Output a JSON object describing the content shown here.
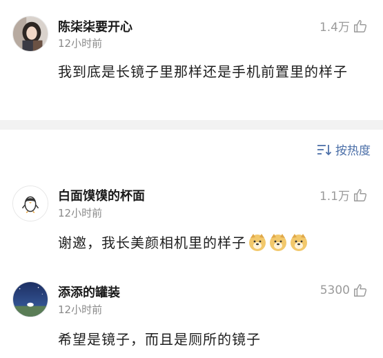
{
  "comments": [
    {
      "username": "陈柒柒要开心",
      "time": "12小时前",
      "likes": "1.4万",
      "content": "我到底是长镜子里那样还是手机前置里的样子",
      "avatar_icon": "girl-portrait-avatar"
    },
    {
      "username": "白面馍馍的杯面",
      "time": "12小时前",
      "likes": "1.1万",
      "content": "谢邀，我长美颜相机里的样子",
      "avatar_icon": "penguin-sketch-avatar",
      "emoji_icon": "doge-emoji",
      "emoji_count": 3
    },
    {
      "username": "添添的罐装",
      "time": "12小时前",
      "likes": "5300",
      "content": "希望是镜子，而且是厕所的镜子",
      "avatar_icon": "night-sky-landscape-avatar"
    }
  ],
  "sort": {
    "label": "按热度",
    "icon": "sort-icon"
  },
  "colors": {
    "accent": "#4b6fa8",
    "muted": "#9a9a9a",
    "divider": "#f2f2f2"
  }
}
